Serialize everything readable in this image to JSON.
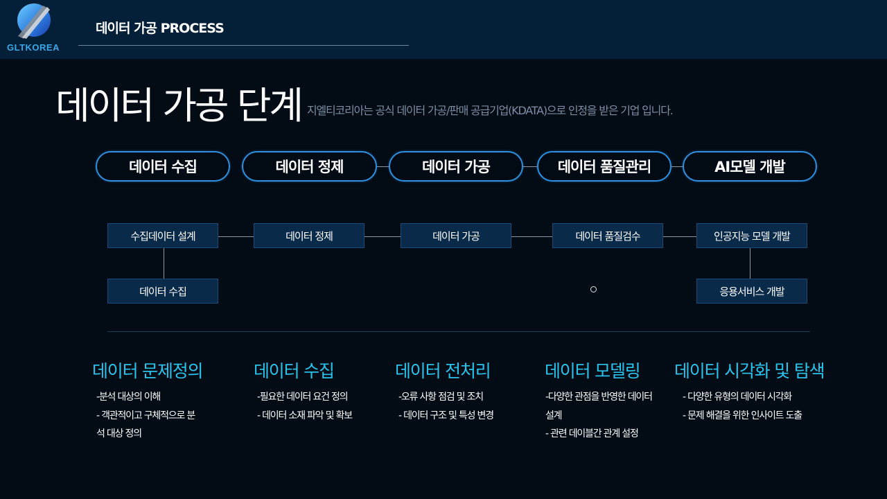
{
  "header": {
    "logo_text": "GLTKOREA",
    "title": "데이터  가공 PROCESS"
  },
  "main": {
    "title": "데이터 가공 단계",
    "subtitle": "지엘티코리아는 공식 데이터 가공/판매 공급기업(KDATA)으로 인정을 받은 기업 입니다."
  },
  "steps": [
    "데이터 수집",
    "데이터 정제",
    "데이터 가공",
    "데이터 품질관리",
    "AI모델 개발"
  ],
  "flow": {
    "top": [
      "수집데이터 설계",
      "데이터 정제",
      "데이터  가공",
      "데이터  품질검수",
      "인공지능 모델 개발"
    ],
    "bottom_left": "데이터 수집",
    "bottom_right": "응용서비스 개발"
  },
  "categories": [
    {
      "title": "데이터 문제정의",
      "items": [
        "-분석 대상의 이해",
        "- 객관적이고 구체적으로 분",
        "석 대상 정의"
      ]
    },
    {
      "title": "데이터 수집",
      "items": [
        "-필요한 데이터 요건 정의",
        "- 데이터 소재 파악 및 확보"
      ]
    },
    {
      "title": "데이터 전처리",
      "items": [
        "-오류 사항 점검  및 조치",
        "- 데이터 구조 및 특성 변경"
      ]
    },
    {
      "title": "데이터 모델링",
      "items": [
        "-다양한 관점을 반영한 데이터",
        "설계",
        "- 관련 데이블간 관계 설정"
      ]
    },
    {
      "title": "데이터 시각화 및 탐색",
      "items": [
        "- 다양한 유형의 데이터 시각화",
        "- 문제 해결을 위한 인사이트 도출"
      ]
    }
  ],
  "colors": {
    "background": "#030b14",
    "header_bg": "#042038",
    "accent_border": "#2e8fe0",
    "box_bg": "#0a2a4a",
    "category_title": "#29c4ee",
    "subtitle": "#7d8ea5"
  }
}
